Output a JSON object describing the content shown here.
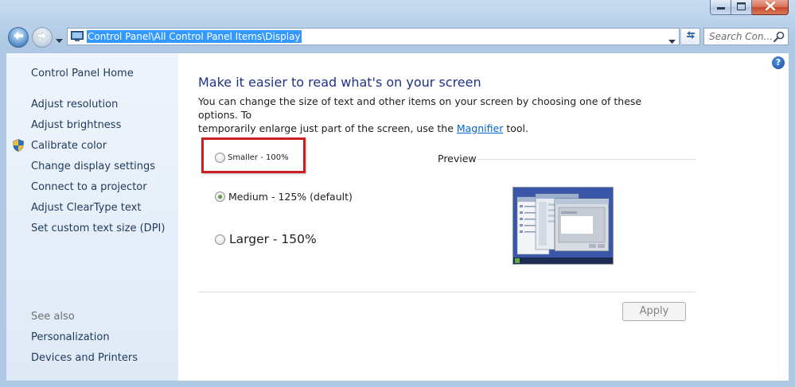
{
  "window": {
    "colors": {
      "accent": "#1e3287",
      "link": "#0066cc",
      "highlight": "#cc1f1f",
      "selection": "#3399ff"
    }
  },
  "caption_buttons": [
    {
      "name": "minimize-button",
      "icon": "minimize-icon"
    },
    {
      "name": "maximize-button",
      "icon": "maximize-icon"
    },
    {
      "name": "close-button",
      "icon": "close-icon"
    }
  ],
  "navbar": {
    "address": "Control Panel\\All Control Panel Items\\Display",
    "search_placeholder": "Search Con..."
  },
  "sidebar": {
    "home_label": "Control Panel Home",
    "links": [
      "Adjust resolution",
      "Adjust brightness",
      "Calibrate color",
      "Change display settings",
      "Connect to a projector",
      "Adjust ClearType text",
      "Set custom text size (DPI)"
    ],
    "see_also_label": "See also",
    "see_also_links": [
      "Personalization",
      "Devices and Printers"
    ]
  },
  "main": {
    "title": "Make it easier to read what's on your screen",
    "description_line1": "You can change the size of text and other items on your screen by choosing one of these options. To",
    "description_pre": "temporarily enlarge just part of the screen, use the ",
    "description_link": "Magnifier",
    "description_post": " tool.",
    "options": [
      {
        "label": "Smaller - 100%",
        "selected": false
      },
      {
        "label": "Medium - 125% (default)",
        "selected": true
      },
      {
        "label": "Larger - 150%",
        "selected": false
      }
    ],
    "preview_label": "Preview",
    "apply_label": "Apply"
  }
}
